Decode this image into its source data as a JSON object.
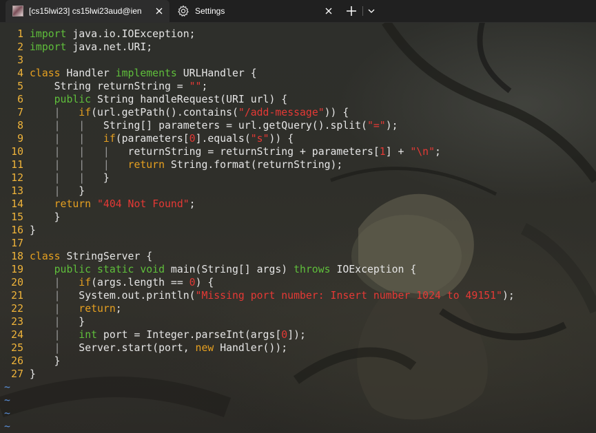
{
  "tabs": [
    {
      "title": "[cs15lwi23]  cs15lwi23aud@ien",
      "active": true,
      "icon": "terminal-profile-icon"
    },
    {
      "title": "Settings",
      "active": false,
      "icon": "gear-icon"
    }
  ],
  "tabbar": {
    "close_glyph": "✕",
    "new_tab_glyph": "+",
    "dropdown_glyph": "⌄"
  },
  "line_numbers": [
    "1",
    "2",
    "3",
    "4",
    "5",
    "6",
    "7",
    "8",
    "9",
    "10",
    "11",
    "12",
    "13",
    "14",
    "15",
    "16",
    "17",
    "18",
    "19",
    "20",
    "21",
    "22",
    "23",
    "24",
    "25",
    "26",
    "27"
  ],
  "tilde": "~",
  "code": {
    "l1": {
      "kw": "import",
      "rest": " java.io.IOException;"
    },
    "l2": {
      "kw": "import",
      "rest": " java.net.URI;"
    },
    "l4": {
      "kw1": "class",
      "name": " Handler ",
      "kw2": "implements",
      "rest": " URLHandler {"
    },
    "l5": {
      "pre": "    String returnString = ",
      "str": "\"\"",
      "post": ";"
    },
    "l6": {
      "pre": "    ",
      "kw": "public",
      "rest": " String handleRequest(URI url) {"
    },
    "l7": {
      "guide": "    |   ",
      "kw": "if",
      "pre": "(url.getPath().contains(",
      "str": "\"/add-message\"",
      "post": ")) {"
    },
    "l8": {
      "guide": "    |   |   ",
      "pre": "String[] parameters = url.getQuery().split(",
      "str": "\"=\"",
      "post": ");"
    },
    "l9": {
      "guide": "    |   |   ",
      "kw": "if",
      "pre": "(parameters[",
      "num": "0",
      "mid": "].equals(",
      "str": "\"s\"",
      "post": ")) {"
    },
    "l10": {
      "guide": "    |   |   |   ",
      "pre": "returnString = returnString + parameters[",
      "num": "1",
      "mid": "] + ",
      "str": "\"\\n\"",
      "post": ";"
    },
    "l11": {
      "guide": "    |   |   |   ",
      "kw": "return",
      "rest": " String.format(returnString);"
    },
    "l12": {
      "guide": "    |   |   ",
      "rest": "}"
    },
    "l13": {
      "guide": "    |   ",
      "rest": "}"
    },
    "l14": {
      "pre": "    ",
      "kw": "return",
      "sp": " ",
      "str": "\"404 Not Found\"",
      "post": ";"
    },
    "l15": {
      "rest": "    }"
    },
    "l16": {
      "rest": "}"
    },
    "l18": {
      "kw1": "class",
      "name": " StringServer",
      "rest": " {"
    },
    "l19": {
      "pre": "    ",
      "kw": "public static void",
      "mid": " main(String[] args) ",
      "kw2": "throws",
      "rest": " IOException {"
    },
    "l20": {
      "guide": "    |   ",
      "kw": "if",
      "pre": "(args.length == ",
      "num": "0",
      "post": ") {"
    },
    "l21": {
      "guide": "    |   ",
      "pre": "System.out.println(",
      "str": "\"Missing port number: Insert number 1024 to 49151\"",
      "post": ");"
    },
    "l22": {
      "guide": "    |   ",
      "kw": "return",
      "rest": ";"
    },
    "l23": {
      "guide": "    |   ",
      "rest": "}"
    },
    "l24": {
      "guide": "    |   ",
      "kw": "int",
      "pre": " port = Integer.parseInt(args[",
      "num": "0",
      "post": "]);"
    },
    "l25": {
      "guide": "    |   ",
      "pre": "Server.start(port, ",
      "kw": "new",
      "post": " Handler());"
    },
    "l26": {
      "rest": "    }"
    },
    "l27": {
      "rest": "}"
    }
  },
  "colors": {
    "line_number": "#f0b43a",
    "keyword": "#5fbf3b",
    "declaration": "#e6a020",
    "string": "#e53935",
    "tilde": "#5a8fd8",
    "text": "#e6e6e6"
  }
}
